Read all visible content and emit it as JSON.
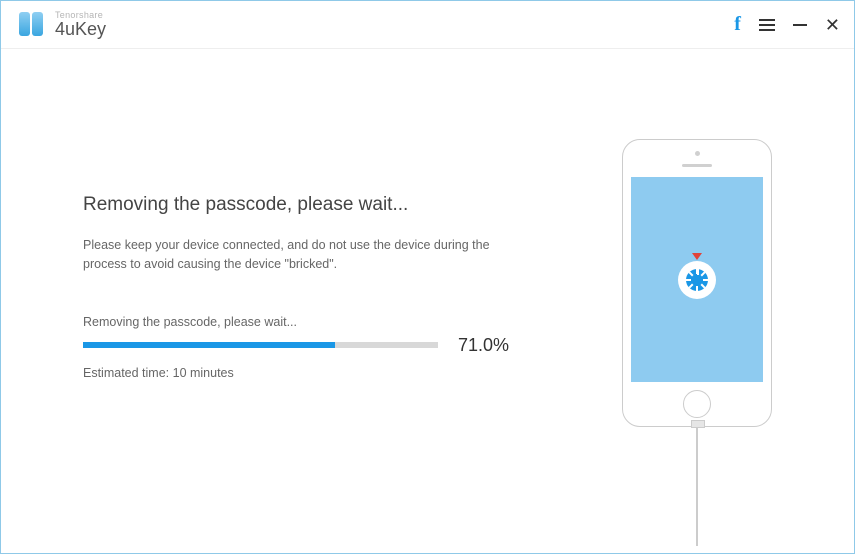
{
  "app": {
    "company": "Tenorshare",
    "product": "4uKey"
  },
  "main": {
    "title": "Removing the passcode, please wait...",
    "description": "Please keep your device connected, and do not use the device during the process to avoid causing the device \"bricked\"."
  },
  "progress": {
    "status_label": "Removing the passcode, please wait...",
    "percent_value": 71.0,
    "percent_display": "71.0%",
    "eta": "Estimated time: 10 minutes"
  },
  "colors": {
    "accent": "#1a97e6",
    "screen": "#8ecbf0"
  }
}
